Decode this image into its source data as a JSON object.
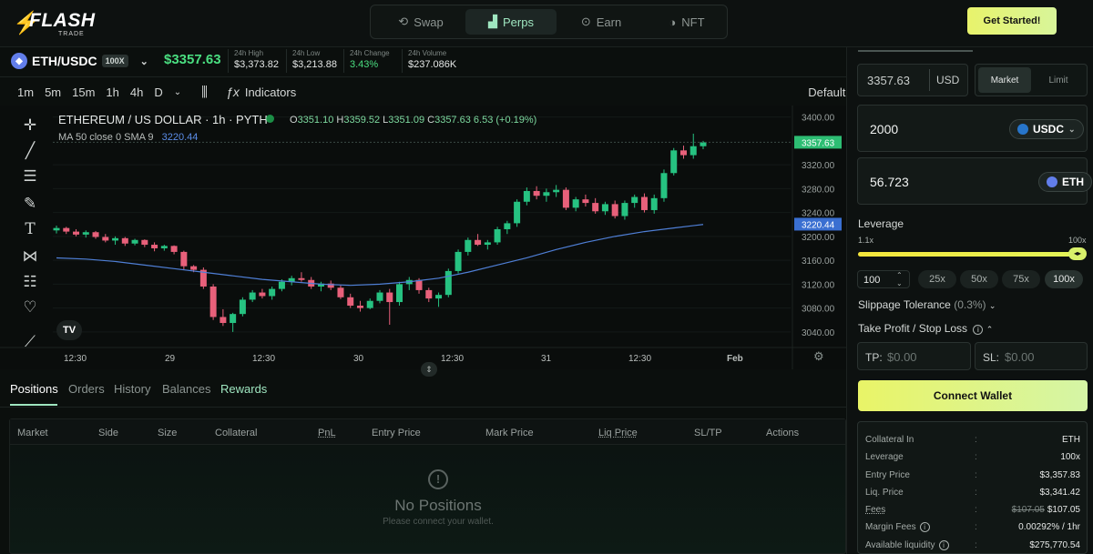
{
  "brand": {
    "name": "FLASH",
    "sub": "TRADE"
  },
  "nav": {
    "tabs": [
      {
        "label": "Swap",
        "icon": "swap-icon"
      },
      {
        "label": "Perps",
        "icon": "chart-icon",
        "active": true
      },
      {
        "label": "Earn",
        "icon": "earn-icon"
      },
      {
        "label": "NFT",
        "icon": "nft-icon"
      }
    ],
    "cta": "Get Started!"
  },
  "ticker": {
    "pair": "ETH/USDC",
    "leverage_badge": "100X",
    "price": "$3357.63",
    "stats": [
      {
        "label": "24h High",
        "value": "$3,373.82"
      },
      {
        "label": "24h Low",
        "value": "$3,213.88"
      },
      {
        "label": "24h Change",
        "value": "3.43%"
      },
      {
        "label": "24h Volume",
        "value": "$237.086K"
      }
    ]
  },
  "chart_toolbar": {
    "timeframes": [
      "1m",
      "5m",
      "15m",
      "1h",
      "4h",
      "D"
    ],
    "indicators": "Indicators",
    "layout": "Default"
  },
  "chart_data": {
    "type": "candlestick",
    "title": "ETHEREUM / US DOLLAR · 1h · PYTH",
    "ohlc": {
      "O": "3351.10",
      "H": "3359.52",
      "L": "3351.09",
      "C": "3357.63",
      "change": "6.53 (+0.19%)"
    },
    "ma_label": "MA 50 close 0 SMA 9",
    "ma_value": "3220.44",
    "last_price": "3357.63",
    "ylim": [
      3020,
      3410
    ],
    "yticks": [
      "3400.00",
      "3320.00",
      "3280.00",
      "3240.00",
      "3200.00",
      "3160.00",
      "3120.00",
      "3080.00",
      "3040.00"
    ],
    "xticks": [
      "12:30",
      "29",
      "12:30",
      "30",
      "12:30",
      "31",
      "12:30",
      "Feb"
    ],
    "candles": [
      [
        3210,
        3218,
        3205,
        3214
      ],
      [
        3214,
        3216,
        3204,
        3208
      ],
      [
        3208,
        3212,
        3200,
        3203
      ],
      [
        3203,
        3210,
        3198,
        3207
      ],
      [
        3207,
        3209,
        3196,
        3199
      ],
      [
        3199,
        3204,
        3190,
        3193
      ],
      [
        3193,
        3200,
        3186,
        3197
      ],
      [
        3197,
        3199,
        3184,
        3188
      ],
      [
        3188,
        3196,
        3185,
        3194
      ],
      [
        3194,
        3195,
        3182,
        3186
      ],
      [
        3186,
        3190,
        3175,
        3180
      ],
      [
        3180,
        3186,
        3176,
        3184
      ],
      [
        3184,
        3185,
        3170,
        3174
      ],
      [
        3174,
        3176,
        3145,
        3150
      ],
      [
        3150,
        3152,
        3140,
        3144
      ],
      [
        3144,
        3148,
        3112,
        3116
      ],
      [
        3116,
        3120,
        3060,
        3065
      ],
      [
        3065,
        3078,
        3050,
        3055
      ],
      [
        3055,
        3072,
        3040,
        3070
      ],
      [
        3070,
        3098,
        3066,
        3094
      ],
      [
        3094,
        3110,
        3090,
        3106
      ],
      [
        3106,
        3112,
        3096,
        3100
      ],
      [
        3100,
        3116,
        3094,
        3112
      ],
      [
        3112,
        3128,
        3108,
        3124
      ],
      [
        3124,
        3134,
        3118,
        3130
      ],
      [
        3130,
        3140,
        3124,
        3127
      ],
      [
        3127,
        3132,
        3112,
        3116
      ],
      [
        3116,
        3124,
        3108,
        3121
      ],
      [
        3121,
        3126,
        3110,
        3114
      ],
      [
        3114,
        3118,
        3095,
        3098
      ],
      [
        3098,
        3104,
        3080,
        3084
      ],
      [
        3084,
        3092,
        3074,
        3080
      ],
      [
        3080,
        3096,
        3078,
        3092
      ],
      [
        3092,
        3110,
        3088,
        3106
      ],
      [
        3106,
        3112,
        3052,
        3090
      ],
      [
        3090,
        3124,
        3084,
        3120
      ],
      [
        3120,
        3132,
        3110,
        3127
      ],
      [
        3127,
        3130,
        3104,
        3110
      ],
      [
        3110,
        3114,
        3090,
        3096
      ],
      [
        3096,
        3106,
        3082,
        3102
      ],
      [
        3102,
        3146,
        3098,
        3142
      ],
      [
        3142,
        3178,
        3138,
        3174
      ],
      [
        3174,
        3198,
        3168,
        3194
      ],
      [
        3194,
        3204,
        3184,
        3186
      ],
      [
        3186,
        3194,
        3178,
        3190
      ],
      [
        3190,
        3216,
        3186,
        3212
      ],
      [
        3212,
        3226,
        3204,
        3222
      ],
      [
        3222,
        3262,
        3216,
        3258
      ],
      [
        3258,
        3282,
        3252,
        3276
      ],
      [
        3276,
        3284,
        3262,
        3268
      ],
      [
        3268,
        3280,
        3258,
        3274
      ],
      [
        3274,
        3286,
        3266,
        3278
      ],
      [
        3278,
        3282,
        3244,
        3248
      ],
      [
        3248,
        3266,
        3242,
        3262
      ],
      [
        3262,
        3270,
        3250,
        3256
      ],
      [
        3256,
        3264,
        3238,
        3242
      ],
      [
        3242,
        3258,
        3236,
        3254
      ],
      [
        3254,
        3260,
        3230,
        3234
      ],
      [
        3234,
        3260,
        3228,
        3256
      ],
      [
        3256,
        3270,
        3248,
        3266
      ],
      [
        3266,
        3272,
        3240,
        3244
      ],
      [
        3244,
        3270,
        3238,
        3264
      ],
      [
        3264,
        3312,
        3258,
        3306
      ],
      [
        3306,
        3348,
        3302,
        3344
      ],
      [
        3344,
        3352,
        3330,
        3336
      ],
      [
        3336,
        3372,
        3330,
        3351
      ],
      [
        3351,
        3360,
        3346,
        3357.63
      ]
    ],
    "ma_series": [
      3164,
      3162,
      3158,
      3152,
      3146,
      3140,
      3134,
      3128,
      3124,
      3120,
      3118,
      3120,
      3124,
      3130,
      3140,
      3152,
      3164,
      3178,
      3190,
      3200,
      3208,
      3214,
      3220
    ]
  },
  "positions": {
    "tabs": [
      "Positions",
      "Orders",
      "History",
      "Balances",
      "Rewards"
    ],
    "columns": [
      "Market",
      "Side",
      "Size",
      "Collateral",
      "PnL",
      "Entry Price",
      "Mark Price",
      "Liq Price",
      "SL/TP",
      "Actions"
    ],
    "empty_title": "No Positions",
    "empty_sub": "Please connect your wallet."
  },
  "order": {
    "price_value": "3357.63",
    "price_unit": "USD",
    "order_types": [
      "Market",
      "Limit"
    ],
    "pay_amount": "2000",
    "pay_token": "USDC",
    "receive_amount": "56.723",
    "receive_token": "ETH",
    "leverage_label": "Leverage",
    "lev_min": "1.1x",
    "lev_max": "100x",
    "lev_fraction": 1.0,
    "lev_input": "100",
    "lev_presets": [
      "25x",
      "50x",
      "75x",
      "100x"
    ],
    "slippage_label": "Slippage Tolerance",
    "slippage_value": "(0.3%)",
    "tpsl_label": "Take Profit / Stop Loss",
    "tp_label": "TP:",
    "tp_placeholder": "$0.00",
    "sl_label": "SL:",
    "sl_placeholder": "$0.00",
    "connect": "Connect Wallet",
    "summary": [
      {
        "label": "Collateral In",
        "value": "ETH"
      },
      {
        "label": "Leverage",
        "value": "100x"
      },
      {
        "label": "Entry Price",
        "value": "$3,357.83"
      },
      {
        "label": "Liq. Price",
        "value": "$3,341.42"
      },
      {
        "label": "Fees",
        "old": "$107.05",
        "value": "$107.05"
      },
      {
        "label": "Margin Fees",
        "value": "0.00292% / 1hr"
      },
      {
        "label": "Available liquidity",
        "value": "$275,770.54"
      }
    ]
  }
}
